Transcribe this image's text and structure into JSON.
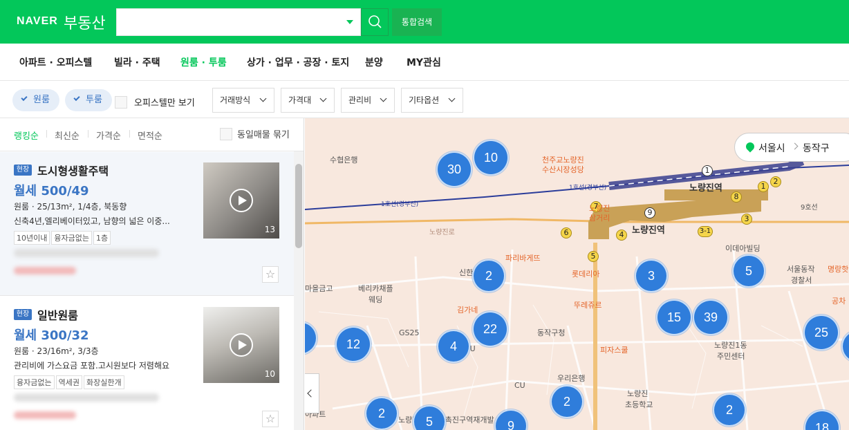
{
  "header": {
    "brand_naver": "NAVER",
    "brand_service": "부동산",
    "search_placeholder": "",
    "integrated_search": "통합검색"
  },
  "nav": {
    "items": [
      {
        "label": "아파트 · 오피스텔",
        "active": false
      },
      {
        "label": "빌라 · 주택",
        "active": false
      },
      {
        "label": "원룸 · 투룸",
        "active": true
      },
      {
        "label": "상가 · 업무 · 공장 · 토지",
        "active": false
      },
      {
        "label": "분양",
        "active": false
      },
      {
        "label": "MY관심",
        "active": false
      }
    ]
  },
  "filters": {
    "chips": [
      "원룸",
      "투룸"
    ],
    "officetel_only": "오피스텔만 보기",
    "dropdowns": [
      "거래방식",
      "가격대",
      "관리비",
      "기타옵션"
    ]
  },
  "sort": {
    "options": [
      "랭킹순",
      "최신순",
      "가격순",
      "면적순"
    ],
    "active_index": 0,
    "group_same": "동일매물 묶기"
  },
  "listings": [
    {
      "badge": "현장",
      "title": "도시형생활주택",
      "price": "월세 500/49",
      "spec": "원룸 · 25/13m², 1/4층, 북동향",
      "desc": "신축4년,엘리베이터있고, 남향의 넓은 이중...",
      "tags": [
        "10년이내",
        "융자금없는",
        "1층"
      ],
      "photo_count": "13"
    },
    {
      "badge": "현장",
      "title": "일반원룸",
      "price": "월세 300/32",
      "spec": "원룸 · 23/16m², 3/3층",
      "desc": "관리비에 가스요금 포함.고시원보다 저렴해요",
      "tags": [
        "융자금없는",
        "역세권",
        "화장실한개"
      ],
      "photo_count": "10"
    }
  ],
  "map": {
    "breadcrumb": {
      "city": "서울시",
      "district": "동작구"
    },
    "clusters": [
      "30",
      "10",
      "2",
      "3",
      "5",
      "15",
      "39",
      "22",
      "12",
      "4",
      "25",
      "2",
      "2",
      "2",
      "5",
      "9",
      "18"
    ],
    "labels": {
      "station_main": "노량진역",
      "station_main2": "노량진역",
      "line1_a": "1호선(경부선)",
      "line1_b": "1호선(경부선)",
      "market": "천주교노량진",
      "market2": "수산시장성당",
      "suhyup": "수협은행",
      "paris": "파리바게뜨",
      "shinhan": "신한",
      "lotteria": "롯데리아",
      "touslesjours": "뚜레쥬르",
      "gimgane": "김가네",
      "gs25": "GS25",
      "dongjak_office": "동작구청",
      "pizza": "피자스쿨",
      "woori": "우리은행",
      "cu": "CU",
      "cu2": "CU",
      "noryang_school": "노량진",
      "noryang_school2": "초등학교",
      "community": "노량진1동",
      "community2": "주민센터",
      "police": "서울동작",
      "police2": "경찰서",
      "idea": "이데아빌딩",
      "wedding": "베리카채플",
      "wedding2": "웨딩",
      "geumgo": "마을금고",
      "noryangjinro": "노량진로",
      "samgeori": "노량진",
      "samgeori2": "삼거리",
      "redevelop": "노량진1재정비촉진구역재개발",
      "apart": "아파트",
      "myeongrang": "명랑핫",
      "gongcha": "공차",
      "exit_9": "9",
      "exit_1": "1",
      "exit_8": "8",
      "exit_7": "7",
      "exit_6": "6",
      "exit_5": "5",
      "exit_4": "4",
      "exit_3": "3",
      "exit_3_1": "3-1",
      "exit_1b": "1",
      "exit_2": "2",
      "line9": "9호선"
    }
  },
  "colors": {
    "brand_green": "#03c75a",
    "accent_blue": "#3a75c4",
    "cluster_blue": "#2f7ddb",
    "map_bg": "#f8e8de"
  }
}
